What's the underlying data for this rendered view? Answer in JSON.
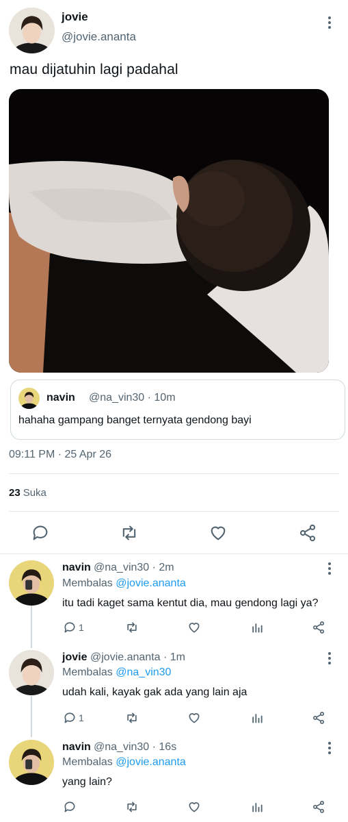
{
  "tweet": {
    "author_name": "jovie",
    "author_handle": "@jovie.ananta",
    "text": "mau dijatuhin lagi padahal",
    "timestamp": "09:11 PM · 25 Apr 26",
    "likes_count": "23",
    "likes_label": "Suka"
  },
  "quote": {
    "name": "navin",
    "handle": "@na_vin30 · 10m",
    "text": "hahaha gampang banget ternyata gendong bayi"
  },
  "replies": [
    {
      "name": "navin",
      "handle": "@na_vin30 · 2m",
      "replying_prefix": "Membalas ",
      "replying_to": "@jovie.ananta",
      "text": "itu tadi kaget sama kentut dia, mau gendong lagi ya?",
      "reply_count": "1"
    },
    {
      "name": "jovie",
      "handle": "@jovie.ananta · 1m",
      "replying_prefix": "Membalas ",
      "replying_to": "@na_vin30",
      "text": "udah kali, kayak gak ada yang lain aja",
      "reply_count": "1"
    },
    {
      "name": "navin",
      "handle": "@na_vin30 · 16s",
      "replying_prefix": "Membalas ",
      "replying_to": "@jovie.ananta",
      "text": "yang lain?",
      "reply_count": ""
    }
  ],
  "colors": {
    "text": "#0f1419",
    "secondary": "#536471",
    "link": "#1d9bf0",
    "border": "#cfd9de"
  }
}
